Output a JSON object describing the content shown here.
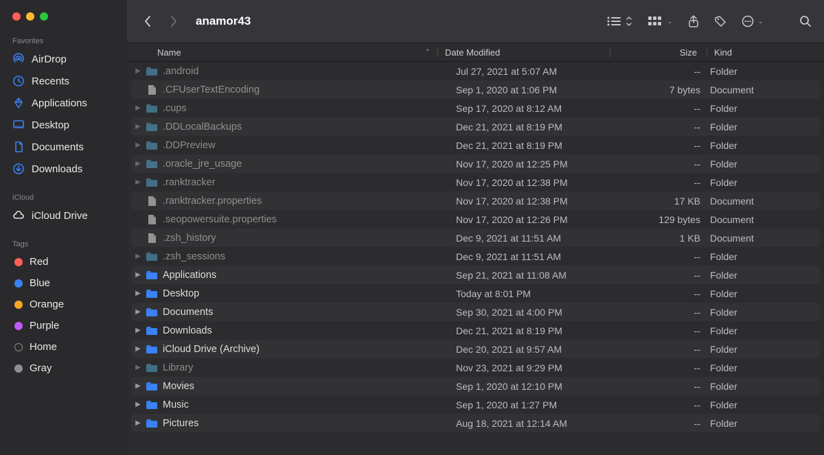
{
  "window": {
    "title": "anamor43"
  },
  "sidebar": {
    "sections": [
      {
        "title": "Favorites",
        "items": [
          {
            "icon": "airdrop",
            "label": "AirDrop"
          },
          {
            "icon": "clock",
            "label": "Recents"
          },
          {
            "icon": "apps",
            "label": "Applications"
          },
          {
            "icon": "desktop",
            "label": "Desktop"
          },
          {
            "icon": "doc",
            "label": "Documents"
          },
          {
            "icon": "download",
            "label": "Downloads"
          }
        ]
      },
      {
        "title": "iCloud",
        "items": [
          {
            "icon": "cloud",
            "label": "iCloud Drive"
          }
        ]
      },
      {
        "title": "Tags",
        "items": [
          {
            "tag_color": "#ff5f57",
            "label": "Red"
          },
          {
            "tag_color": "#3b82f6",
            "label": "Blue"
          },
          {
            "tag_color": "#f5a623",
            "label": "Orange"
          },
          {
            "tag_color": "#bf5af2",
            "label": "Purple"
          },
          {
            "tag_outline": true,
            "label": "Home"
          },
          {
            "tag_color": "#8e8e93",
            "label": "Gray"
          }
        ]
      }
    ]
  },
  "columns": {
    "name": "Name",
    "date": "Date Modified",
    "size": "Size",
    "kind": "Kind"
  },
  "files": [
    {
      "type": "folder",
      "name": ".android",
      "date": "Jul 27, 2021 at 5:07 AM",
      "size": "--",
      "kind": "Folder",
      "hidden": true
    },
    {
      "type": "doc",
      "name": ".CFUserTextEncoding",
      "date": "Sep 1, 2020 at 1:06 PM",
      "size": "7 bytes",
      "kind": "Document",
      "hidden": true
    },
    {
      "type": "folder",
      "name": ".cups",
      "date": "Sep 17, 2020 at 8:12 AM",
      "size": "--",
      "kind": "Folder",
      "hidden": true
    },
    {
      "type": "folder",
      "name": ".DDLocalBackups",
      "date": "Dec 21, 2021 at 8:19 PM",
      "size": "--",
      "kind": "Folder",
      "hidden": true
    },
    {
      "type": "folder",
      "name": ".DDPreview",
      "date": "Dec 21, 2021 at 8:19 PM",
      "size": "--",
      "kind": "Folder",
      "hidden": true
    },
    {
      "type": "folder",
      "name": ".oracle_jre_usage",
      "date": "Nov 17, 2020 at 12:25 PM",
      "size": "--",
      "kind": "Folder",
      "hidden": true
    },
    {
      "type": "folder",
      "name": ".ranktracker",
      "date": "Nov 17, 2020 at 12:38 PM",
      "size": "--",
      "kind": "Folder",
      "hidden": true
    },
    {
      "type": "doc",
      "name": ".ranktracker.properties",
      "date": "Nov 17, 2020 at 12:38 PM",
      "size": "17 KB",
      "kind": "Document",
      "hidden": true
    },
    {
      "type": "doc",
      "name": ".seopowersuite.properties",
      "date": "Nov 17, 2020 at 12:26 PM",
      "size": "129 bytes",
      "kind": "Document",
      "hidden": true
    },
    {
      "type": "doc",
      "name": ".zsh_history",
      "date": "Dec 9, 2021 at 11:51 AM",
      "size": "1 KB",
      "kind": "Document",
      "hidden": true
    },
    {
      "type": "folder",
      "name": ".zsh_sessions",
      "date": "Dec 9, 2021 at 11:51 AM",
      "size": "--",
      "kind": "Folder",
      "hidden": true
    },
    {
      "type": "folder",
      "name": "Applications",
      "date": "Sep 21, 2021 at 11:08 AM",
      "size": "--",
      "kind": "Folder",
      "tint": "#3b82f6"
    },
    {
      "type": "folder",
      "name": "Desktop",
      "date": "Today at 8:01 PM",
      "size": "--",
      "kind": "Folder",
      "tint": "#3b82f6"
    },
    {
      "type": "folder",
      "name": "Documents",
      "date": "Sep 30, 2021 at 4:00 PM",
      "size": "--",
      "kind": "Folder",
      "tint": "#3b82f6"
    },
    {
      "type": "folder",
      "name": "Downloads",
      "date": "Dec 21, 2021 at 8:19 PM",
      "size": "--",
      "kind": "Folder",
      "tint": "#3b82f6"
    },
    {
      "type": "folder",
      "name": "iCloud Drive (Archive)",
      "date": "Dec 20, 2021 at 9:57 AM",
      "size": "--",
      "kind": "Folder",
      "tint": "#3b82f6"
    },
    {
      "type": "folder",
      "name": "Library",
      "date": "Nov 23, 2021 at 9:29 PM",
      "size": "--",
      "kind": "Folder",
      "hidden": true
    },
    {
      "type": "folder",
      "name": "Movies",
      "date": "Sep 1, 2020 at 12:10 PM",
      "size": "--",
      "kind": "Folder",
      "tint": "#3b82f6"
    },
    {
      "type": "folder",
      "name": "Music",
      "date": "Sep 1, 2020 at 1:27 PM",
      "size": "--",
      "kind": "Folder",
      "tint": "#3b82f6"
    },
    {
      "type": "folder",
      "name": "Pictures",
      "date": "Aug 18, 2021 at 12:14 AM",
      "size": "--",
      "kind": "Folder",
      "tint": "#3b82f6"
    }
  ]
}
